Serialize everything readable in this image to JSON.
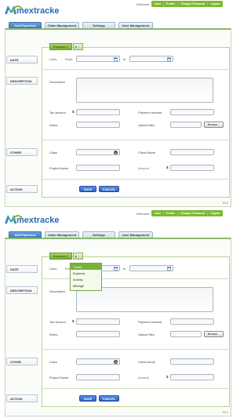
{
  "app": {
    "logo_text": "mextracker",
    "welcome": "Welcome"
  },
  "topnav": [
    "User",
    "Profile",
    "Change Password",
    "Logout"
  ],
  "tabs": [
    "Add Expenses",
    "Claim Management",
    "Settings",
    "User Management"
  ],
  "sections": {
    "date": "DATE",
    "description": "DESCRIPTION",
    "other": "OTHER",
    "action": "ACTION"
  },
  "expense_button": {
    "label": "Expense 1",
    "arrow": "▸ ..."
  },
  "form": {
    "conv_label": "Conv.",
    "from_label": "From",
    "to_label": "to",
    "description_label": "Description",
    "tax_label": "Tax amount",
    "currency_symbol": "$",
    "payment_label": "Payment method",
    "notes_label": "Notes",
    "upload_label": "Upload files",
    "browse_label": "Browse...",
    "class_label": "Class",
    "client_label": "Client Name",
    "project_label": "Project Name",
    "amount_label": "Amount",
    "save_label": "SAVE",
    "cancel_label": "CANCEL"
  },
  "dropdown_options": [
    "Travel",
    "Expense",
    "Activity",
    "Mileage"
  ],
  "dropdown_selected": "Travel",
  "version": "V1.2",
  "colors": {
    "accent_green": "#7fb832",
    "tab_blue": "#3a77c0",
    "button_blue": "#2d62c4"
  }
}
